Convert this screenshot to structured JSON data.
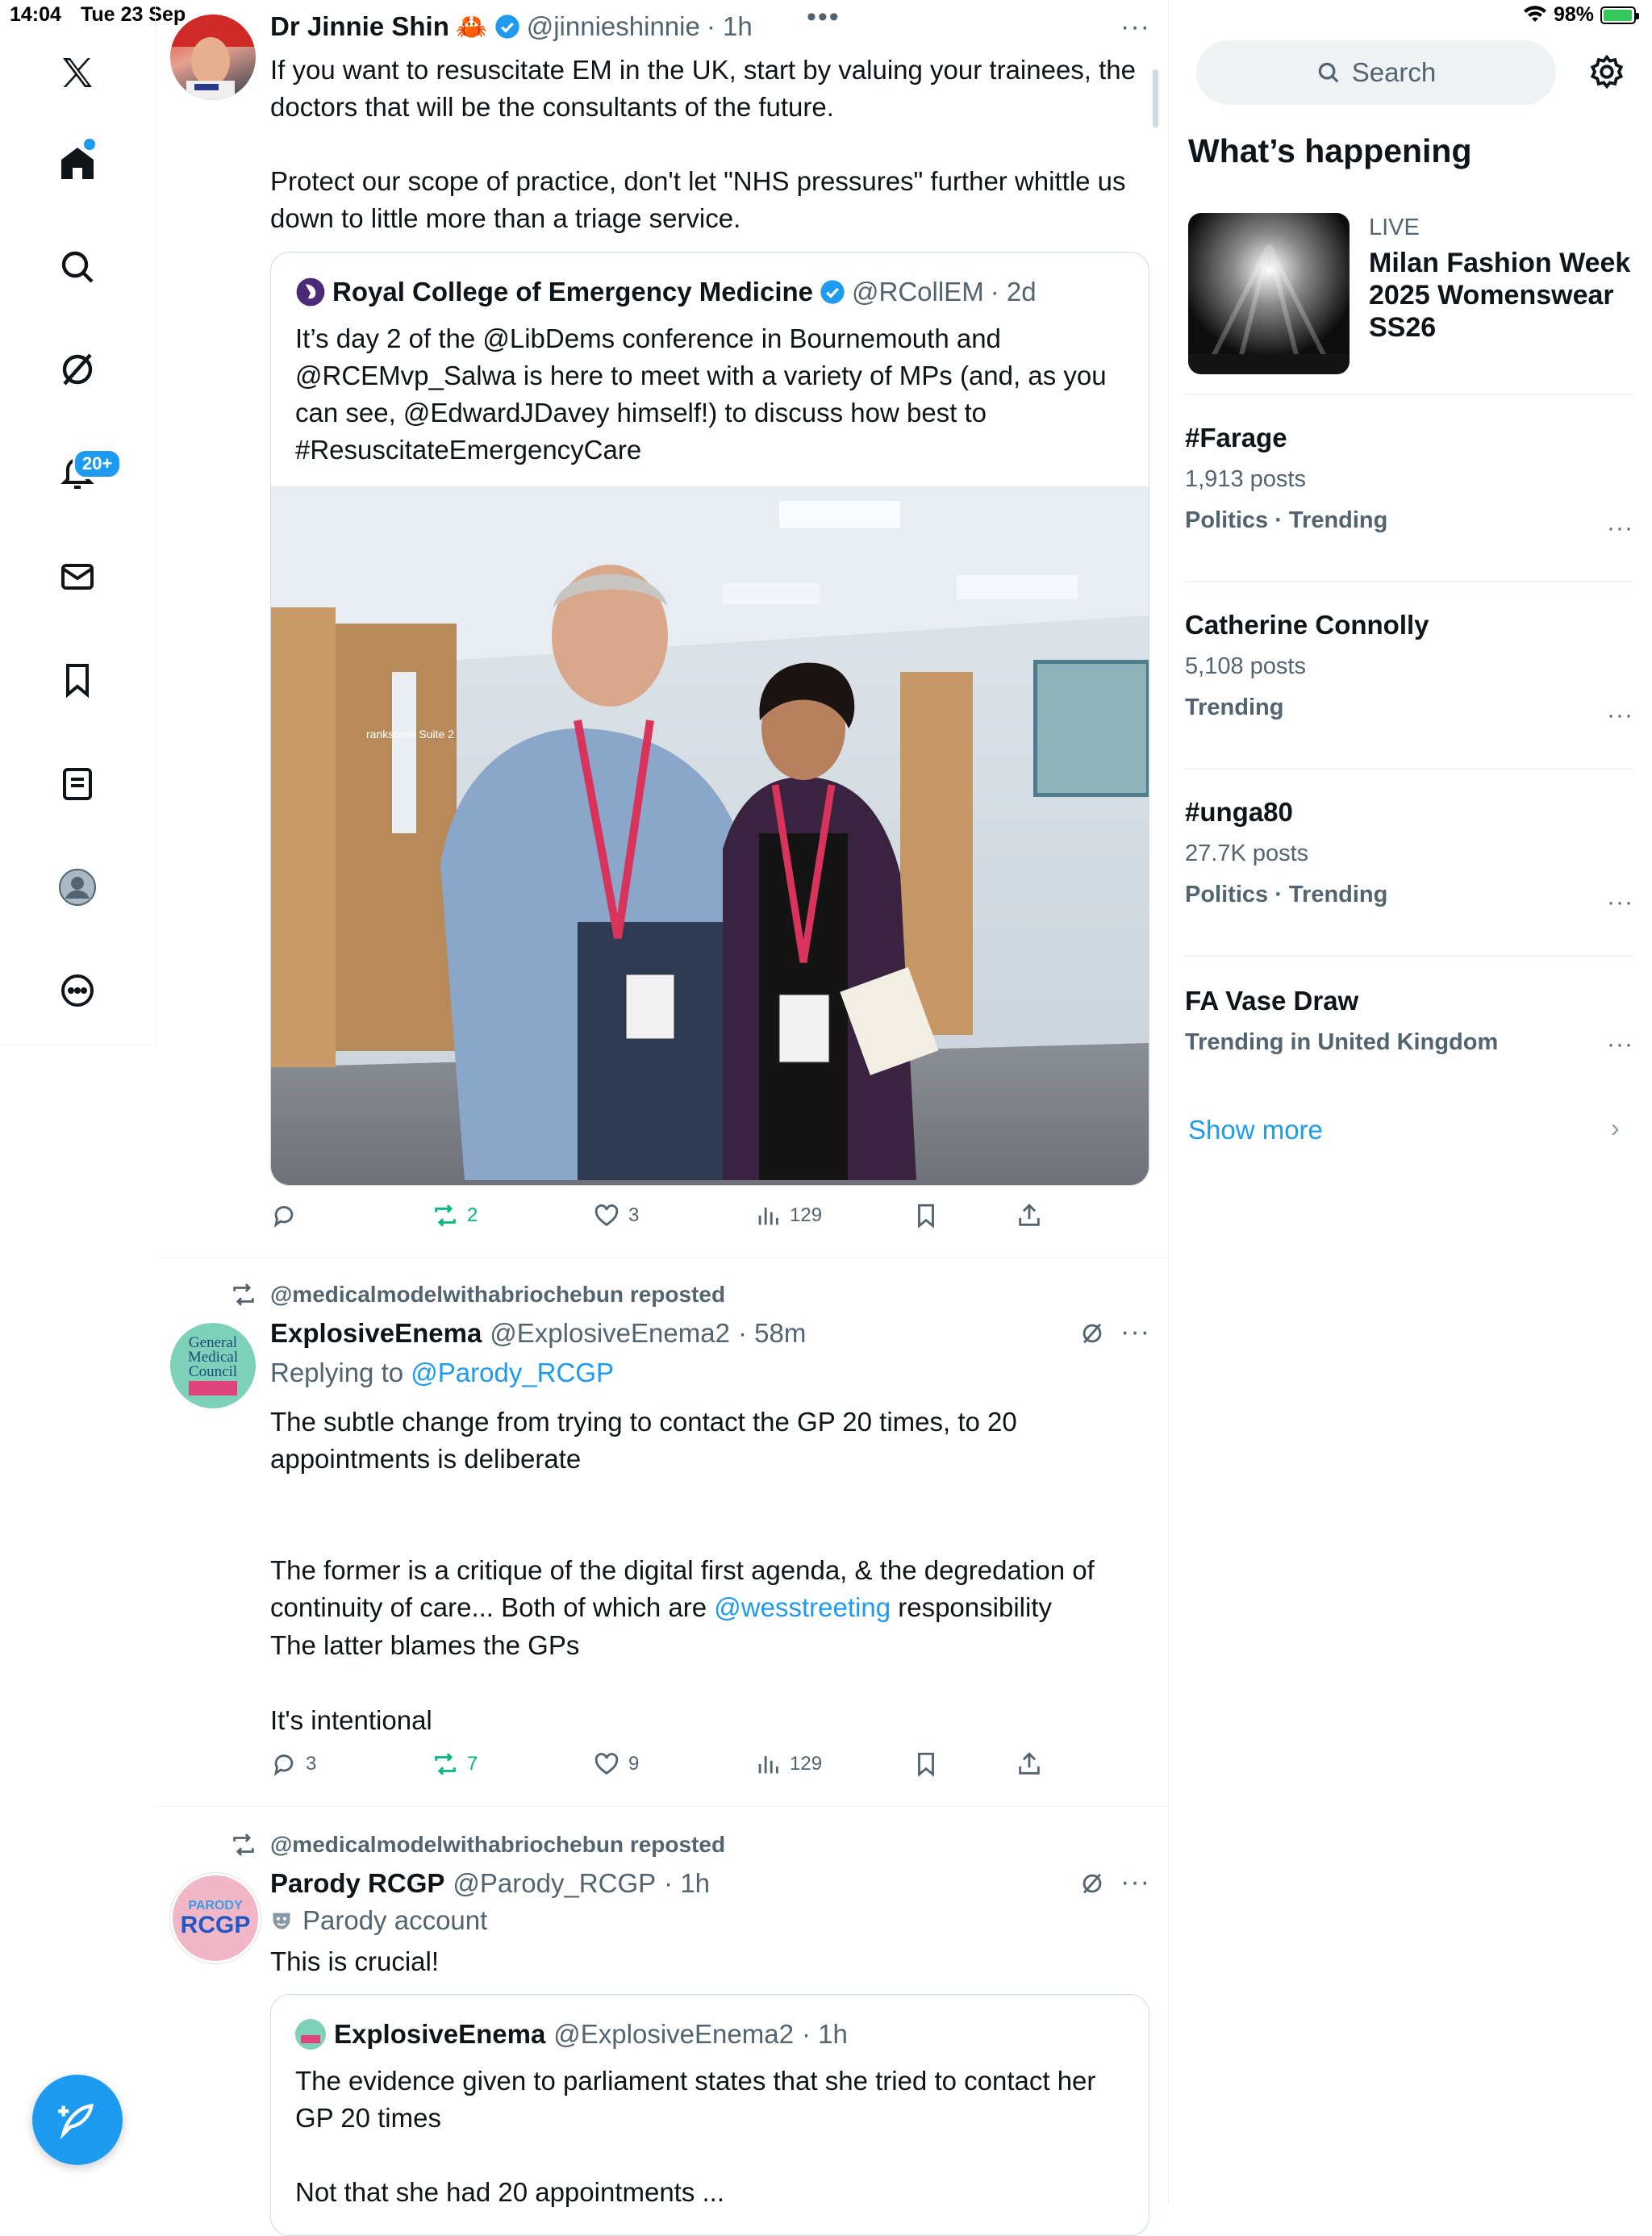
{
  "status": {
    "time": "14:04",
    "date": "Tue 23 Sep",
    "battery": "98%",
    "battery_level": 0.98
  },
  "nav": {
    "items": [
      "home",
      "search",
      "grok",
      "notifications",
      "messages",
      "bookmarks",
      "lists",
      "profile",
      "more"
    ],
    "notifications_badge": "20+"
  },
  "colors": {
    "accent": "#1d9bf0",
    "repost": "#00ba7c",
    "text": "#0f1419",
    "muted": "#536471"
  },
  "tweet1": {
    "name": "Dr Jinnie Shin",
    "emoji": "🦀",
    "handle": "@jinnieshinnie",
    "time": "· 1h",
    "text": "If you want to resuscitate EM in the UK, start by valuing your trainees, the doctors that will be the consultants of the future.\n\nProtect our scope of practice, don't let \"NHS pressures\" further whittle us down to little more than a triage service.",
    "quote": {
      "name": "Royal College of Emergency Medicine",
      "handle": "@RCollEM",
      "time": "· 2d",
      "text": "It’s day 2 of the @LibDems conference in Bournemouth and @RCEMvp_Salwa is here to meet with a variety of MPs (and, as you can see, @EdwardJDavey himself!) to discuss how best to #ResuscitateEmergencyCare",
      "image_sign": "ranksome Suite 2"
    },
    "actions": {
      "reply": "",
      "repost": "2",
      "like": "3",
      "views": "129"
    }
  },
  "tweet2": {
    "reposted_by": "@medicalmodelwithabriochebun reposted",
    "name": "ExplosiveEnema",
    "handle": "@ExplosiveEnema2",
    "time": "· 58m",
    "avatar_text": "General Medical Council",
    "replying_prefix": "Replying to ",
    "replying_to": "@Parody_RCGP",
    "text_p1": "The subtle change from trying to contact the GP 20 times, to 20 appointments is deliberate",
    "text_p2_a": "The former is a critique of the digital first agenda, & the degredation of continuity of care... Both of which are ",
    "text_p2_link": "@wesstreeting",
    "text_p2_b": " responsibility",
    "text_p3": "The latter blames the GPs",
    "text_p4": "It's intentional",
    "actions": {
      "reply": "3",
      "repost": "7",
      "like": "9",
      "views": "129"
    }
  },
  "tweet3": {
    "reposted_by": "@medicalmodelwithabriochebun reposted",
    "name": "Parody RCGP",
    "handle": "@Parody_RCGP",
    "time": "· 1h",
    "avatar_top": "PARODY",
    "avatar_main": "RCGP",
    "parody_label": "Parody account",
    "text": "This is crucial!",
    "quote": {
      "name": "ExplosiveEnema",
      "handle": "@ExplosiveEnema2",
      "time": "· 1h",
      "text": "The evidence given to parliament states that she tried to contact her GP 20 times\n\nNot that she had 20 appointments ..."
    }
  },
  "sidebar": {
    "search_placeholder": "Search",
    "section_title": "What’s happening",
    "live": {
      "label": "LIVE",
      "title": "Milan Fashion Week 2025 Womenswear SS26"
    },
    "trends": [
      {
        "title": "#Farage",
        "posts": "1,913 posts",
        "category": "Politics · Trending"
      },
      {
        "title": "Catherine Connolly",
        "posts": "5,108 posts",
        "category": "Trending"
      },
      {
        "title": "#unga80",
        "posts": "27.7K posts",
        "category": "Politics · Trending"
      },
      {
        "title": "FA Vase Draw",
        "posts": "",
        "category": "Trending in United Kingdom"
      }
    ],
    "show_more": "Show more"
  }
}
